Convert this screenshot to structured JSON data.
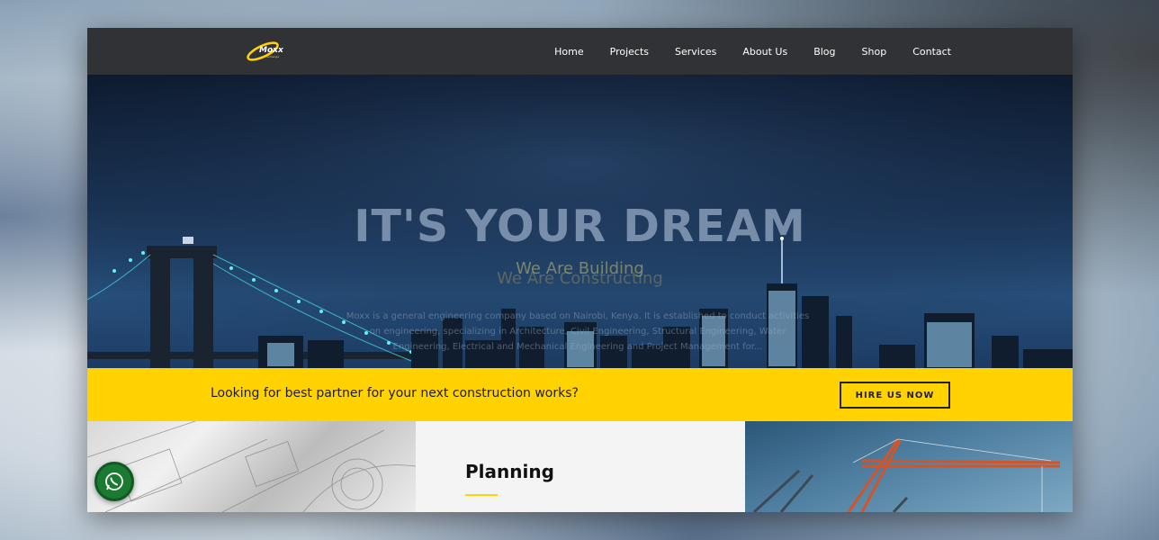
{
  "brand": {
    "logo_text": "Moxx",
    "logo_subtext": "Samanga",
    "accent_color": "#ffd200",
    "header_bg": "#303236"
  },
  "nav": {
    "items": [
      {
        "label": "Home"
      },
      {
        "label": "Projects"
      },
      {
        "label": "Services"
      },
      {
        "label": "About Us"
      },
      {
        "label": "Blog"
      },
      {
        "label": "Shop"
      },
      {
        "label": "Contact"
      }
    ]
  },
  "hero": {
    "title": "IT'S YOUR DREAM",
    "subtitle_primary": "We Are Building",
    "subtitle_secondary": "We Are Constructing",
    "description": "Moxx is a general engineering company based on Nairobi, Kenya. It is established to conduct activities on engineering, specializing in Architecture, Civil Engineering, Structural Engineering, Water Engineering, Electrical and Mechanical Engineering and Project Management for..."
  },
  "cta": {
    "text": "Looking for best partner for your next construction works?",
    "button_label": "HIRE US NOW"
  },
  "features": {
    "planning_title": "Planning"
  },
  "floating": {
    "whatsapp_icon": "whatsapp-icon"
  }
}
